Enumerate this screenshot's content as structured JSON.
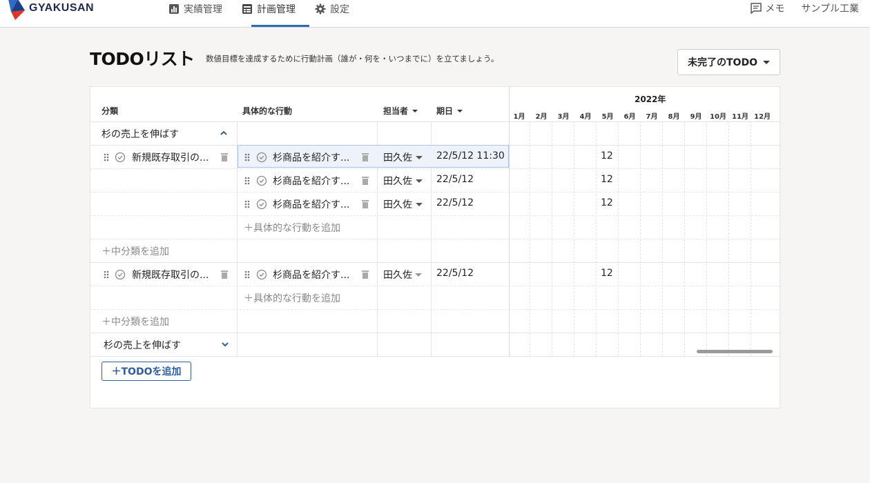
{
  "app": {
    "logo_text": "GYAKUSAN"
  },
  "nav": [
    {
      "label": "実績管理",
      "icon": "bar-chart-icon",
      "active": false
    },
    {
      "label": "計画管理",
      "icon": "calendar-table-icon",
      "active": true
    },
    {
      "label": "設定",
      "icon": "gear-icon",
      "active": false
    }
  ],
  "header_right": {
    "memo": "メモ",
    "company": "サンプル工業"
  },
  "page": {
    "title": "TODOリスト",
    "subtitle": "数値目標を達成するために行動計画（誰が・何を・いつまでに）を立てましょう。",
    "filter_label": "未完了のTODO"
  },
  "table": {
    "headers": {
      "category": "分類",
      "action": "具体的な行動",
      "assignee": "担当者",
      "due": "期日"
    },
    "year": "2022年",
    "months": [
      "1月",
      "2月",
      "3月",
      "4月",
      "5月",
      "6月",
      "7月",
      "8月",
      "9月",
      "10月",
      "11月",
      "12月"
    ],
    "group1": {
      "title": "杉の売上を伸ばす",
      "sub1": {
        "name": "新規既存取引の...",
        "actions": [
          {
            "text": "杉商品を紹介す...",
            "assignee": "田久佐",
            "due": "22/5/12 11:30",
            "gantt": "12"
          },
          {
            "text": "杉商品を紹介す...",
            "assignee": "田久佐",
            "due": "22/5/12",
            "gantt": "12"
          },
          {
            "text": "杉商品を紹介す...",
            "assignee": "田久佐",
            "due": "22/5/12",
            "gantt": "12"
          }
        ],
        "add_action": "具体的な行動を追加"
      },
      "add_sub1": "中分類を追加",
      "sub2": {
        "name": "新規既存取引の...",
        "actions": [
          {
            "text": "杉商品を紹介す...",
            "assignee": "田久佐",
            "due": "22/5/12",
            "gantt": "12"
          }
        ],
        "add_action": "具体的な行動を追加"
      },
      "add_sub2": "中分類を追加"
    },
    "group2": {
      "title": "杉の売上を伸ばす"
    },
    "add_todo": "＋TODOを追加"
  },
  "colors": {
    "accent": "#2f6bb5",
    "button_border": "#2f5e9e"
  }
}
